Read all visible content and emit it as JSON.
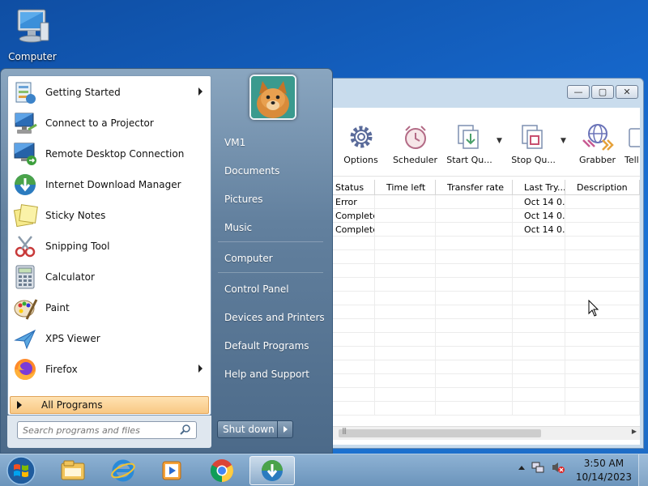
{
  "desktop": {
    "computer_icon_label": "Computer"
  },
  "idm": {
    "toolbar": [
      {
        "label": "Options",
        "icon": "gear-icon"
      },
      {
        "label": "Scheduler",
        "icon": "alarm-clock-icon"
      },
      {
        "label": "Start Qu...",
        "icon": "start-queue-icon"
      },
      {
        "label": "Stop Qu...",
        "icon": "stop-queue-icon"
      },
      {
        "label": "Grabber",
        "icon": "grabber-icon"
      },
      {
        "label": "Tell a",
        "icon": "tell-a-friend-icon"
      }
    ],
    "columns": [
      "Status",
      "Time left",
      "Transfer rate",
      "Last Try...",
      "Description"
    ],
    "rows": [
      {
        "status": "Error",
        "time_left": "",
        "rate": "",
        "last_try": "Oct 14 0...",
        "description": ""
      },
      {
        "status": "Complete",
        "time_left": "",
        "rate": "",
        "last_try": "Oct 14 0...",
        "description": ""
      },
      {
        "status": "Complete",
        "time_left": "",
        "rate": "",
        "last_try": "Oct 14 0...",
        "description": ""
      }
    ],
    "window_buttons": {
      "minimize": "—",
      "restore": "▢",
      "close": "✕"
    }
  },
  "start_menu": {
    "programs": [
      {
        "label": "Getting Started",
        "icon": "getting-started-icon",
        "submenu": true
      },
      {
        "label": "Connect to a Projector",
        "icon": "projector-icon",
        "submenu": false
      },
      {
        "label": "Remote Desktop Connection",
        "icon": "remote-desktop-icon",
        "submenu": false
      },
      {
        "label": "Internet Download Manager",
        "icon": "idm-icon",
        "submenu": false
      },
      {
        "label": "Sticky Notes",
        "icon": "sticky-notes-icon",
        "submenu": false
      },
      {
        "label": "Snipping Tool",
        "icon": "snipping-tool-icon",
        "submenu": false
      },
      {
        "label": "Calculator",
        "icon": "calculator-icon",
        "submenu": false
      },
      {
        "label": "Paint",
        "icon": "paint-icon",
        "submenu": false
      },
      {
        "label": "XPS Viewer",
        "icon": "xps-viewer-icon",
        "submenu": false
      },
      {
        "label": "Firefox",
        "icon": "firefox-icon",
        "submenu": true
      }
    ],
    "all_programs": "All Programs",
    "search_placeholder": "Search programs and files",
    "right_links": [
      {
        "label": "VM1"
      },
      {
        "label": "Documents"
      },
      {
        "label": "Pictures"
      },
      {
        "label": "Music"
      },
      {
        "label": "Computer"
      },
      {
        "label": "Control Panel"
      },
      {
        "label": "Devices and Printers"
      },
      {
        "label": "Default Programs"
      },
      {
        "label": "Help and Support"
      }
    ],
    "shutdown_label": "Shut down"
  },
  "taskbar": {
    "pinned": [
      "explorer-icon",
      "internet-explorer-icon",
      "media-player-icon",
      "chrome-icon",
      "idm-icon"
    ],
    "time": "3:50 AM",
    "date": "10/14/2023"
  }
}
